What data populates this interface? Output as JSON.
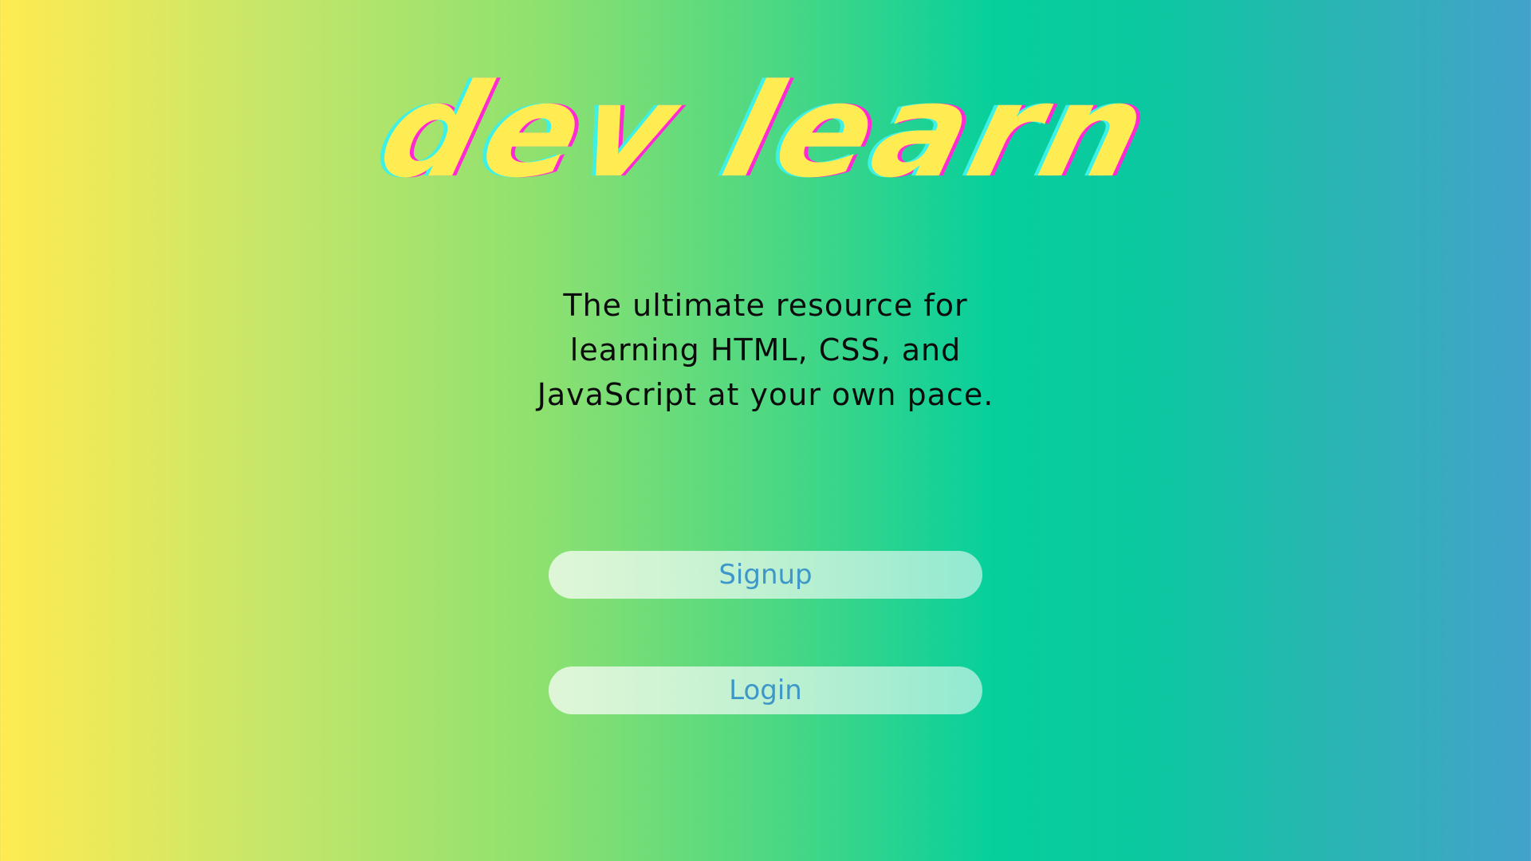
{
  "logo": {
    "text": "dev learn"
  },
  "tagline": "The ultimate resource for learning HTML, CSS, and JavaScript at your own pace.",
  "buttons": {
    "signup": "Signup",
    "login": "Login"
  },
  "colors": {
    "logo_fill": "#FFEB52",
    "logo_shadow_cyan": "#3EF1E6",
    "logo_shadow_magenta": "#FF2AD4",
    "button_text": "#3E97C9",
    "gradient_left": "#FFEB52",
    "gradient_mid": "#06CF9C",
    "gradient_right": "#42A2CB"
  }
}
